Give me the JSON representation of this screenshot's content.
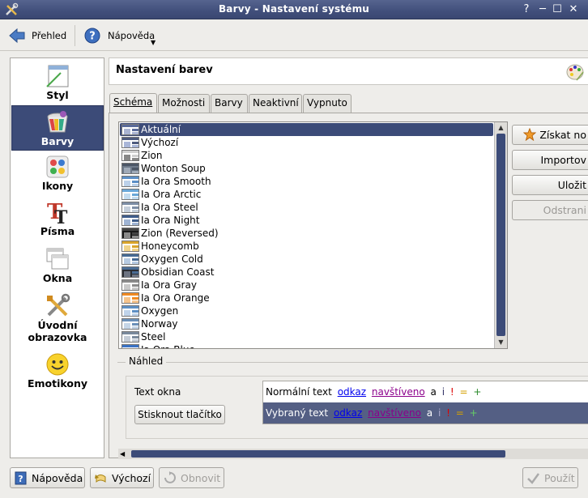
{
  "window": {
    "title": "Barvy - Nastavení systému",
    "help_glyph": "?",
    "min_glyph": "─",
    "max_glyph": "☐",
    "close_glyph": "✕"
  },
  "toolbar": {
    "overview_label": "Přehled",
    "help_label": "Nápověda"
  },
  "sidebar": {
    "items": [
      {
        "label": "Styl",
        "icon": "style-icon"
      },
      {
        "label": "Barvy",
        "icon": "colors-icon",
        "active": true
      },
      {
        "label": "Ikony",
        "icon": "icons-icon"
      },
      {
        "label": "Písma",
        "icon": "fonts-icon"
      },
      {
        "label": "Okna",
        "icon": "windows-icon"
      },
      {
        "label": "Úvodní obrazovka",
        "icon": "splash-icon"
      },
      {
        "label": "Emotikony",
        "icon": "emoticons-icon"
      }
    ]
  },
  "header": {
    "title": "Nastavení barev"
  },
  "tabs": [
    "Schéma",
    "Možnosti",
    "Barvy",
    "Neaktivní",
    "Vypnuto"
  ],
  "schemes": [
    {
      "name": "Aktuální",
      "selected": true,
      "colors": [
        "#ffffff",
        "#5a6b9a",
        "#aab4d2"
      ]
    },
    {
      "name": "Výchozí",
      "colors": [
        "#ffffff",
        "#4d5a7e",
        "#a9b6d8"
      ]
    },
    {
      "name": "Zion",
      "colors": [
        "#ffffff",
        "#cfcfcf",
        "#888888"
      ]
    },
    {
      "name": "Wonton Soup",
      "colors": [
        "#6e7a8a",
        "#4c5666",
        "#a0aab8"
      ]
    },
    {
      "name": "Ia Ora Smooth",
      "colors": [
        "#ffffff",
        "#5b8ec6",
        "#bcd1ea"
      ]
    },
    {
      "name": "Ia Ora Arctic",
      "colors": [
        "#ffffff",
        "#6aa7d8",
        "#c3dcf0"
      ]
    },
    {
      "name": "Ia Ora Steel",
      "colors": [
        "#ffffff",
        "#7d8ea5",
        "#c5cfdb"
      ]
    },
    {
      "name": "Ia Ora Night",
      "colors": [
        "#ffffff",
        "#3e5c8a",
        "#9fb4d4"
      ]
    },
    {
      "name": "Zion (Reversed)",
      "colors": [
        "#1a1a1a",
        "#444444",
        "#8a8a8a"
      ]
    },
    {
      "name": "Honeycomb",
      "colors": [
        "#ffffff",
        "#d9a52b",
        "#f1d48a"
      ]
    },
    {
      "name": "Oxygen Cold",
      "colors": [
        "#ffffff",
        "#466a94",
        "#b7cbe2"
      ]
    },
    {
      "name": "Obsidian Coast",
      "colors": [
        "#2a2d33",
        "#4a6c94",
        "#6d7482"
      ]
    },
    {
      "name": "Ia Ora Gray",
      "colors": [
        "#ffffff",
        "#8b8b8b",
        "#c9c9c9"
      ]
    },
    {
      "name": "Ia Ora Orange",
      "colors": [
        "#ffffff",
        "#f08a22",
        "#f6c48c"
      ]
    },
    {
      "name": "Oxygen",
      "colors": [
        "#ffffff",
        "#5d8fc4",
        "#bfd3ea"
      ]
    },
    {
      "name": "Norway",
      "colors": [
        "#ffffff",
        "#6a8fb8",
        "#c5d5e7"
      ]
    },
    {
      "name": "Steel",
      "colors": [
        "#ffffff",
        "#7a8a9c",
        "#c4ccd6"
      ]
    },
    {
      "name": "Ia Ora Blue",
      "colors": [
        "#ffffff",
        "#3a72c4",
        "#b2cbee"
      ]
    }
  ],
  "actions": {
    "get_new": "Získat no",
    "import": "Importov",
    "save": "Uložit",
    "remove": "Odstrani"
  },
  "preview": {
    "title": "Náhled",
    "window_text": "Text okna",
    "push_button": "Stisknout tlačítko",
    "normal_text": "Normální text",
    "selected_text": "Vybraný text",
    "link": "odkaz",
    "visited": "navštíveno",
    "sym_a": "a",
    "sym_i": "i",
    "sym_excl": "!",
    "sym_eq": "=",
    "sym_plus": "+"
  },
  "bottom": {
    "help": "Nápověda",
    "defaults": "Výchozí",
    "reset": "Obnovit",
    "apply": "Použít"
  },
  "colors": {
    "selection": "#3c4b78",
    "titlebar": "#414f7b",
    "link": "#0000ee",
    "visited": "#8b008b"
  }
}
